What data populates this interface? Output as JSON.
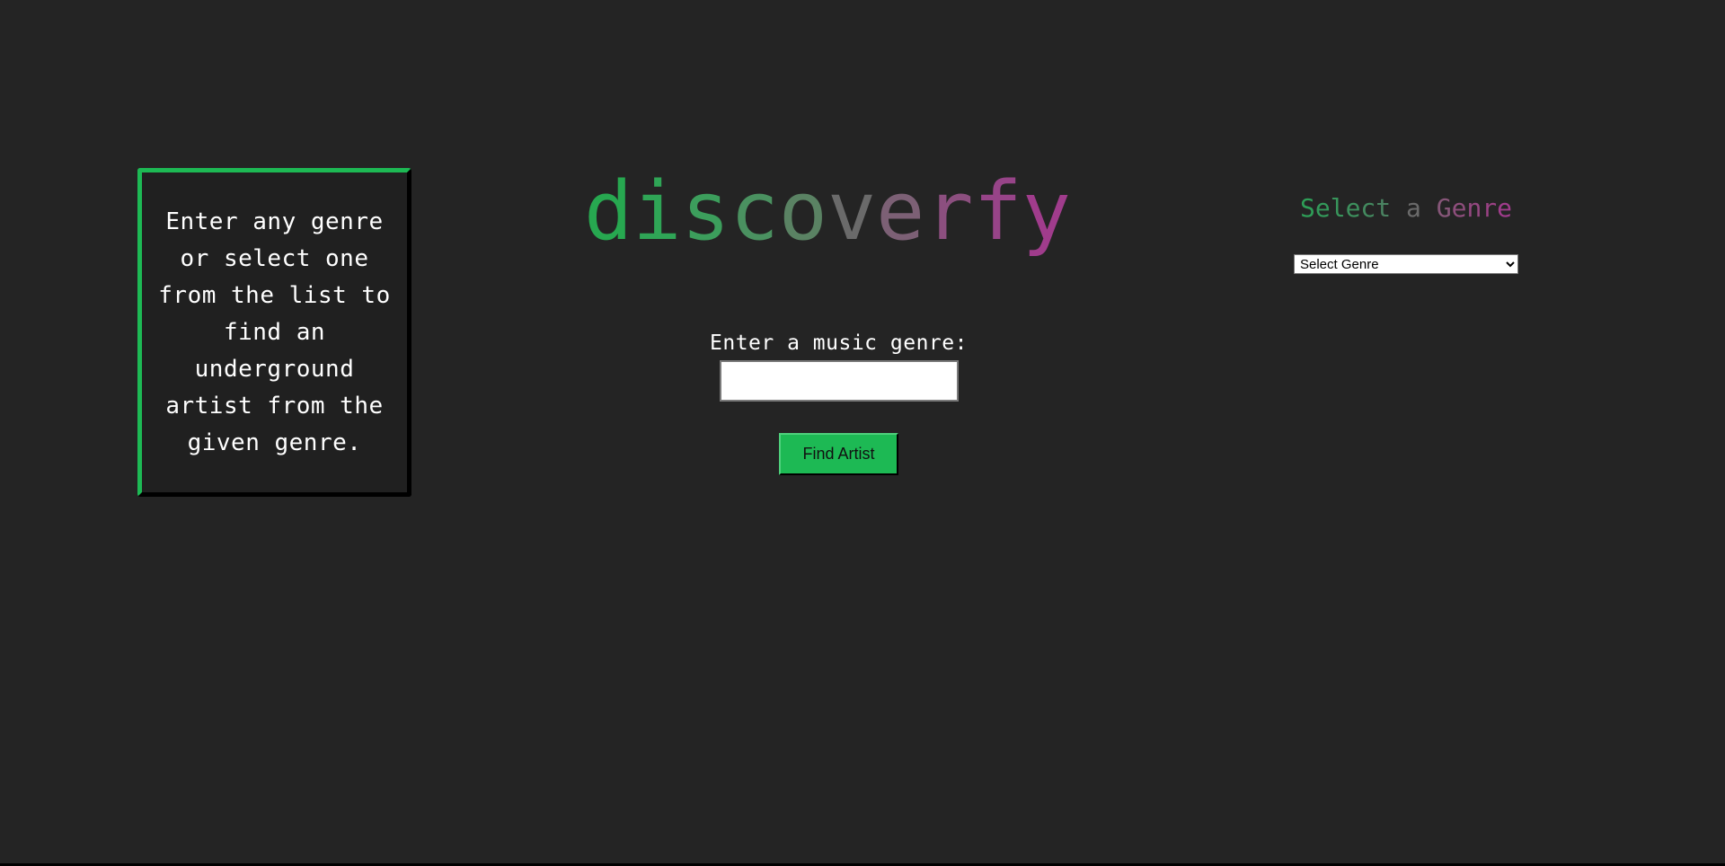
{
  "info": {
    "text": "Enter any genre or select one from the list to find an underground artist from the given genre."
  },
  "logo": {
    "letters": [
      "d",
      "i",
      "s",
      "c",
      "o",
      "v",
      "e",
      "r",
      "f",
      "y"
    ],
    "colors": [
      "#27a850",
      "#2fa556",
      "#3c9e5c",
      "#4a9160",
      "#5a8263",
      "#6a6a6a",
      "#7c6075",
      "#8c4f7f",
      "#974488",
      "#a03c8c"
    ]
  },
  "form": {
    "label": "Enter a music genre:",
    "input_value": "",
    "input_placeholder": "",
    "button_label": "Find Artist",
    "button_color": "#1db954"
  },
  "genre_select": {
    "heading_letters": [
      "S",
      "e",
      "l",
      "e",
      "c",
      "t",
      " ",
      "a",
      " ",
      "G",
      "e",
      "n",
      "r",
      "e"
    ],
    "heading_colors": [
      "#2e9e57",
      "#33995a",
      "#38955b",
      "#3d905d",
      "#438a5f",
      "#4a8361",
      "#5a7466",
      "#6a6a6a",
      "#7a5f73",
      "#865678",
      "#8e4e7c",
      "#944880",
      "#9a4284",
      "#a03c8c"
    ],
    "selected_option": "Select Genre"
  },
  "colors": {
    "background": "#242424",
    "accent_green": "#1db954",
    "accent_pink": "#a03c8c"
  }
}
